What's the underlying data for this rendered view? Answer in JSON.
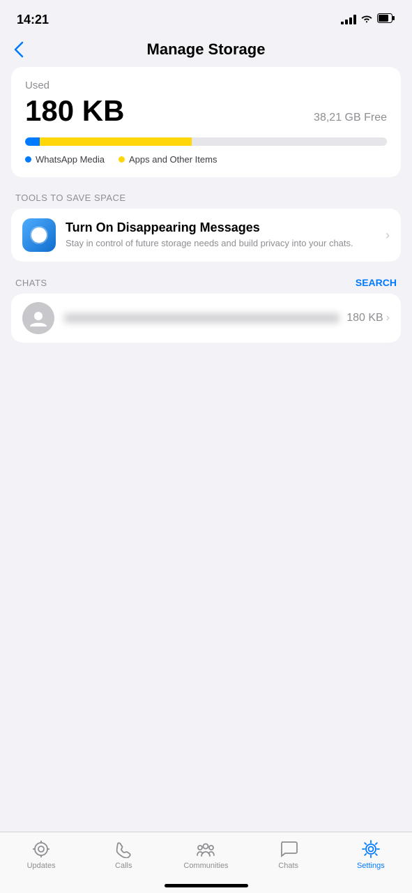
{
  "statusBar": {
    "time": "14:21"
  },
  "header": {
    "title": "Manage Storage",
    "backLabel": "‹"
  },
  "storageCard": {
    "usedLabel": "Used",
    "usedValue": "180 KB",
    "freeValue": "38,21 GB Free",
    "legend": [
      {
        "label": "WhatsApp Media",
        "color": "#007aff"
      },
      {
        "label": "Apps and Other Items",
        "color": "#ffd60a"
      }
    ]
  },
  "toolsSection": {
    "sectionLabel": "TOOLS TO SAVE SPACE",
    "item": {
      "title": "Turn On Disappearing Messages",
      "subtitle": "Stay in control of future storage needs and build privacy into your chats."
    }
  },
  "chatsSection": {
    "sectionLabel": "CHATS",
    "searchLabel": "SEARCH",
    "chatItem": {
      "size": "180 KB"
    }
  },
  "tabBar": {
    "items": [
      {
        "label": "Updates",
        "key": "updates"
      },
      {
        "label": "Calls",
        "key": "calls"
      },
      {
        "label": "Communities",
        "key": "communities"
      },
      {
        "label": "Chats",
        "key": "chats"
      },
      {
        "label": "Settings",
        "key": "settings",
        "active": true
      }
    ]
  }
}
